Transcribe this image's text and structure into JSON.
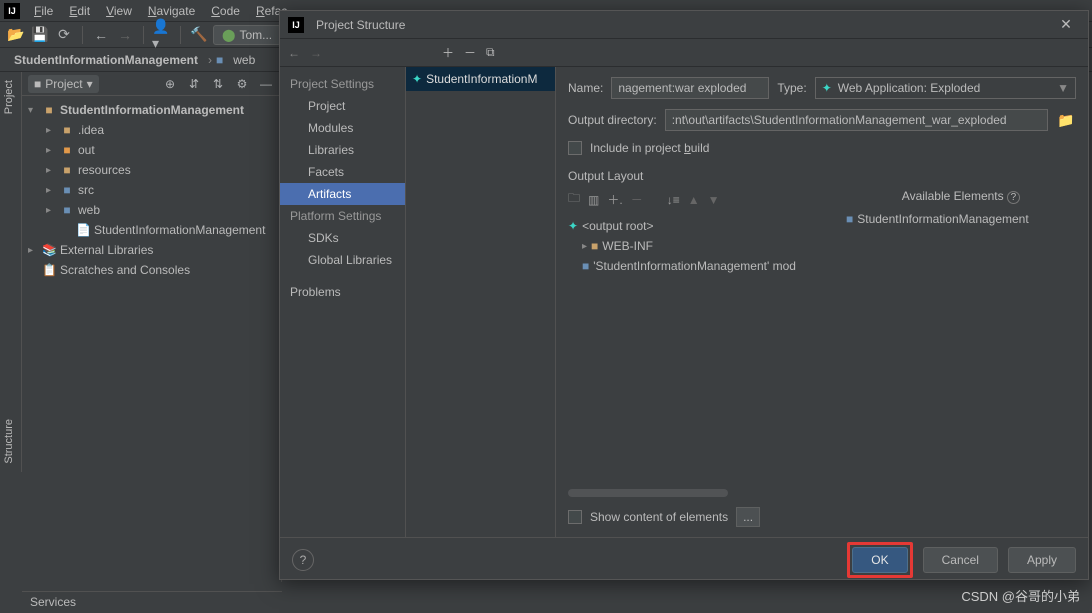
{
  "menubar": {
    "file": "File",
    "edit": "Edit",
    "view": "View",
    "navigate": "Navigate",
    "code": "Code",
    "refactor": "Refac..."
  },
  "toolbar": {
    "run_config": "Tom..."
  },
  "breadcrumb": {
    "project": "StudentInformationManagement",
    "web": "web"
  },
  "sidetab": {
    "project": "Project",
    "structure": "Structure"
  },
  "project_pane": {
    "title": "Project",
    "root": "StudentInformationManagement",
    "idea": ".idea",
    "out": "out",
    "resources": "resources",
    "src": "src",
    "web": "web",
    "iml": "StudentInformationManagement",
    "ext": "External Libraries",
    "scratch": "Scratches and Consoles"
  },
  "services": "Services",
  "modal": {
    "title": "Project Structure",
    "cats": {
      "project_settings": "Project Settings",
      "project": "Project",
      "modules": "Modules",
      "libraries": "Libraries",
      "facets": "Facets",
      "artifacts": "Artifacts",
      "platform_settings": "Platform Settings",
      "sdks": "SDKs",
      "global_libs": "Global Libraries",
      "problems": "Problems"
    },
    "artifact_item": "StudentInformationM",
    "name_label": "Name:",
    "name_value": "nagement:war exploded",
    "type_label": "Type:",
    "type_value": "Web Application: Exploded",
    "outdir_label": "Output directory:",
    "outdir_value": ":nt\\out\\artifacts\\StudentInformationManagement_war_exploded",
    "include_label": "Include in project build",
    "output_layout": "Output Layout",
    "available": "Available Elements",
    "tree": {
      "root": "<output root>",
      "webinf": "WEB-INF",
      "mod": "'StudentInformationManagement' mod"
    },
    "avail_item": "StudentInformationManagement",
    "show_content": "Show content of elements",
    "ok": "OK",
    "cancel": "Cancel",
    "apply": "Apply"
  },
  "watermark": "CSDN @谷哥的小弟"
}
